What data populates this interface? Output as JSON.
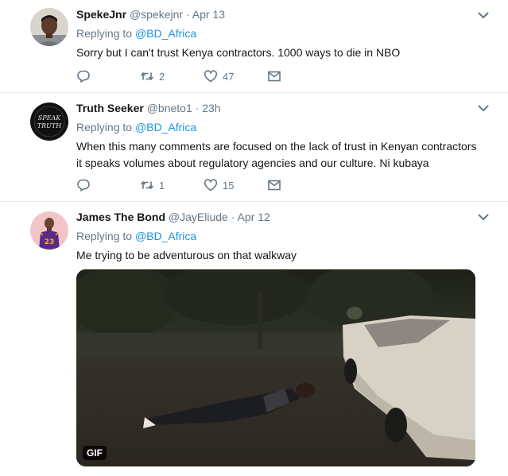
{
  "tweets": [
    {
      "display_name": "SpekeJnr",
      "handle": "@spekejnr",
      "dot": "·",
      "time": "Apr 13",
      "replying_prefix": "Replying to ",
      "replying_to": "@BD_Africa",
      "text": "Sorry but I can't trust Kenya contractors. 1000 ways to die in NBO",
      "retweets": "2",
      "likes": "47"
    },
    {
      "display_name": "Truth Seeker",
      "handle": "@bneto1",
      "dot": "·",
      "time": "23h",
      "replying_prefix": "Replying to ",
      "replying_to": "@BD_Africa",
      "text_line1": "When this many comments are focused on the lack of trust in Kenyan contractors",
      "text_line2": "it speaks volumes about regulatory agencies and our culture. Ni kubaya",
      "retweets": "1",
      "likes": "15",
      "avatar_text_1": "SPEAK",
      "avatar_text_2": "TRUTH"
    },
    {
      "display_name": "James The Bond",
      "handle": "@JayEliude",
      "dot": "·",
      "time": "Apr 12",
      "replying_prefix": "Replying to ",
      "replying_to": "@BD_Africa",
      "text": "Me trying to be adventurous on that walkway",
      "media_badge": "GIF",
      "jersey_number": "23"
    }
  ],
  "colors": {
    "link": "#1b95e0",
    "secondary_text": "#657786",
    "primary_text": "#14171a",
    "divider": "#e6ecf0"
  }
}
